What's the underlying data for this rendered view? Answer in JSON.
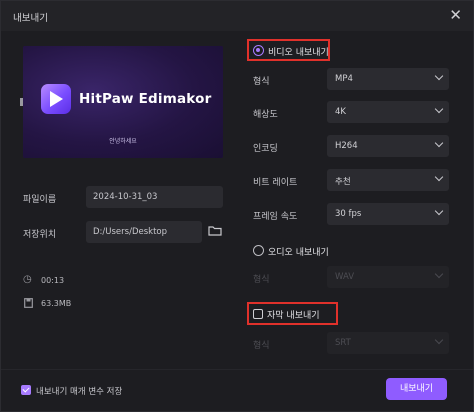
{
  "window": {
    "title": "내보내기",
    "close_glyph": "✕"
  },
  "preview": {
    "brand": "HitPaw Edimakor",
    "subtitle": "안녕하세요"
  },
  "file": {
    "name_label": "파일이름",
    "name_value": "2024-10-31_03",
    "path_label": "저장위치",
    "path_value": "D:/Users/Desktop"
  },
  "info": {
    "duration": "00:13",
    "size": "63.3MB"
  },
  "video_export": {
    "title": "비디오 내보내기",
    "selected": true,
    "rows": [
      {
        "label": "형식",
        "value": "MP4"
      },
      {
        "label": "해상도",
        "value": "4K"
      },
      {
        "label": "인코딩",
        "value": "H264"
      },
      {
        "label": "비트 레이트",
        "value": "추천"
      },
      {
        "label": "프레임 속도",
        "value": "30  fps"
      }
    ]
  },
  "audio_export": {
    "title": "오디오 내보내기",
    "selected": false,
    "rows": [
      {
        "label": "형식",
        "value": "WAV"
      }
    ]
  },
  "subtitle_export": {
    "title": "자막 내보내기",
    "checked": false,
    "rows": [
      {
        "label": "형식",
        "value": "SRT"
      }
    ]
  },
  "footer": {
    "remember_label": "내보내기 매개 변수 저장",
    "remember_checked": true,
    "export_button": "내보내기"
  },
  "colors": {
    "accent": "#8f5cff",
    "highlight_box": "#e0312b",
    "background": "#1d1d21"
  }
}
